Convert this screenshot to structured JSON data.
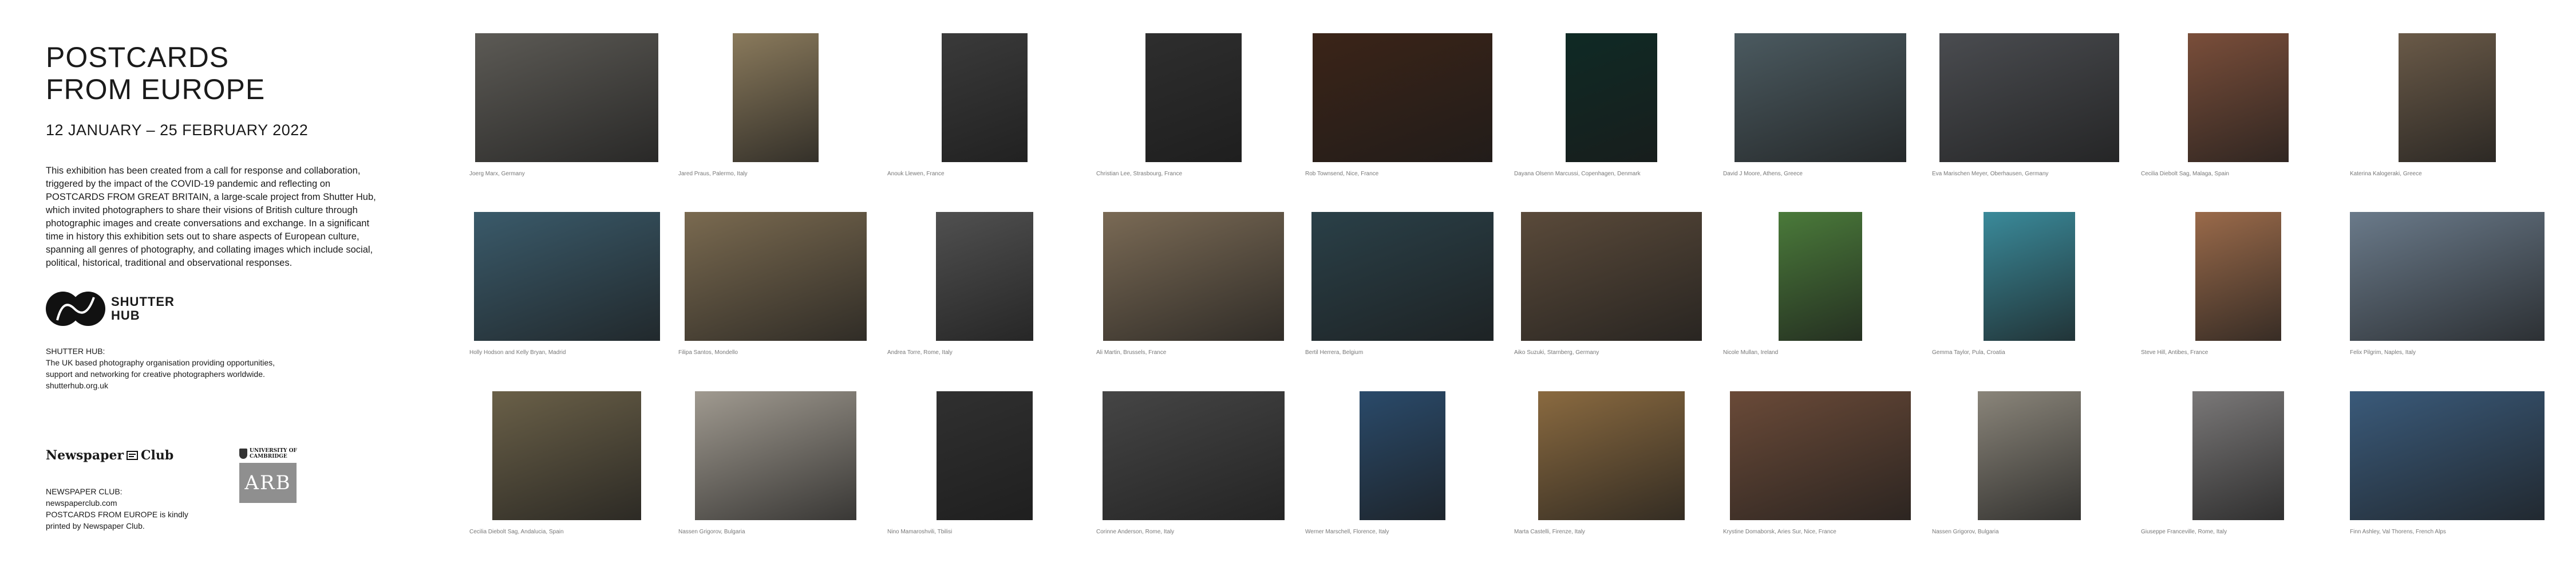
{
  "exhibition": {
    "title_line1": "POSTCARDS",
    "title_line2": "FROM EUROPE",
    "dates": "12 JANUARY – 25 FEBRUARY 2022",
    "description": "This exhibition has been created from a call for response and collaboration, triggered by the impact of the COVID-19 pandemic and reflecting on POSTCARDS FROM GREAT BRITAIN, a large-scale project from Shutter Hub, which invited photographers to share their visions of British culture through photographic images and create conversations and exchange. In a significant time in history this exhibition sets out to share aspects of European culture, spanning all genres of photography, and collating images which include social, political, historical, traditional and observational responses."
  },
  "shutter_hub": {
    "logo_line1": "SHUTTER",
    "logo_line2": "HUB",
    "heading": "SHUTTER HUB:",
    "line1": "The UK based photography organisation providing opportunities,",
    "line2": "support and networking for creative photographers worldwide.",
    "url": "shutterhub.org.uk"
  },
  "newspaper_club": {
    "logo_left": "Newspaper",
    "logo_right": "Club",
    "heading": "NEWSPAPER CLUB:",
    "url": "newspaperclub.com",
    "line1": "POSTCARDS FROM EUROPE is kindly",
    "line2": "printed by Newspaper Club."
  },
  "cambridge": {
    "line1": "UNIVERSITY OF",
    "line2": "CAMBRIDGE",
    "mark": "ARB"
  },
  "colors": {
    "text": "#1a1a1a",
    "caption": "#777777",
    "background": "#ffffff"
  },
  "photos": [
    {
      "caption": "Joerg Marx, Germany",
      "tone": "#5c5a55"
    },
    {
      "caption": "Jared Praus, Palermo, Italy",
      "tone": "#8a7a5c"
    },
    {
      "caption": "Anouk Llewen, France",
      "tone": "#3a3a3a"
    },
    {
      "caption": "Christian Lee, Strasbourg, France",
      "tone": "#2e2e2e"
    },
    {
      "caption": "Rob Townsend, Nice, France",
      "tone": "#3b2418"
    },
    {
      "caption": "Dayana Olsenn Marcussi, Copenhagen, Denmark",
      "tone": "#0f2a25"
    },
    {
      "caption": "David J Moore, Athens, Greece",
      "tone": "#4b5a60"
    },
    {
      "caption": "Eva Marischen Meyer, Oberhausen, Germany",
      "tone": "#4a4c50"
    },
    {
      "caption": "Cecilia Diebolt Sag, Malaga, Spain",
      "tone": "#7a4e3a"
    },
    {
      "caption": "Katerina Kalogeraki, Greece",
      "tone": "#6a5a48"
    },
    {
      "caption": "Holly Hodson and Kelly Bryan, Madrid",
      "tone": "#3a5a6a"
    },
    {
      "caption": "Filipa Santos, Mondello",
      "tone": "#7a6a50"
    },
    {
      "caption": "Andrea Torre, Rome, Italy",
      "tone": "#505050"
    },
    {
      "caption": "Ali Martin, Brussels, France",
      "tone": "#7a6a55"
    },
    {
      "caption": "Bertil Herrera, Belgium",
      "tone": "#2a4048"
    },
    {
      "caption": "Aiko Suzuki, Starnberg, Germany",
      "tone": "#5a4a3a"
    },
    {
      "caption": "Nicole Mullan, Ireland",
      "tone": "#4a7a3a"
    },
    {
      "caption": "Gemma Taylor, Pula, Croatia",
      "tone": "#3a8a9a"
    },
    {
      "caption": "Steve Hill, Antibes, France",
      "tone": "#9a6a4a"
    },
    {
      "caption": "Felix Pilgrim, Naples, Italy",
      "tone": "#6a7a8a"
    },
    {
      "caption": "Cecilia Diebolt Sag, Andalucia, Spain",
      "tone": "#6a6048"
    },
    {
      "caption": "Nassen Grigorov, Bulgaria",
      "tone": "#a09a90"
    },
    {
      "caption": "Nino Mamaroshvili, Tbilisi",
      "tone": "#303030"
    },
    {
      "caption": "Corinne Anderson, Rome, Italy",
      "tone": "#454545"
    },
    {
      "caption": "Werner Marschell, Florence, Italy",
      "tone": "#2a4a6a"
    },
    {
      "caption": "Marta Castelli, Firenze, Italy",
      "tone": "#8a6a40"
    },
    {
      "caption": "Krystine Domaborsk, Aries Sur, Nice, France",
      "tone": "#6a4a38"
    },
    {
      "caption": "Nassen Grigorov, Bulgaria",
      "tone": "#8a857a"
    },
    {
      "caption": "Giuseppe Franceville, Rome, Italy",
      "tone": "#7a7878"
    },
    {
      "caption": "Finn Ashley, Val Thorens, French Alps",
      "tone": "#3a5a7a"
    }
  ]
}
